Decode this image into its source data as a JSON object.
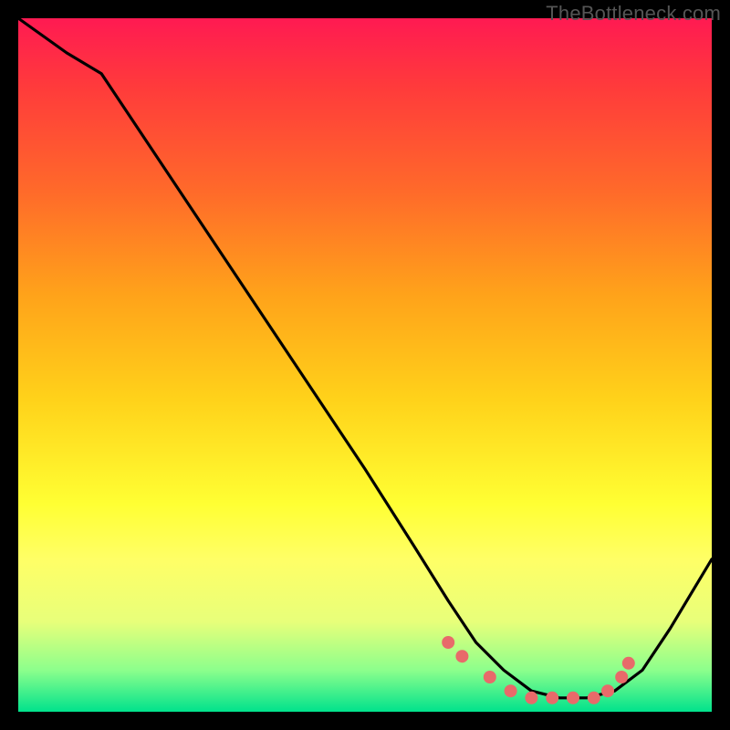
{
  "watermark": "TheBottleneck.com",
  "chart_data": {
    "type": "line",
    "title": "",
    "xlabel": "",
    "ylabel": "",
    "xlim": [
      0,
      100
    ],
    "ylim": [
      0,
      100
    ],
    "series": [
      {
        "name": "curve",
        "x": [
          0,
          7,
          12,
          20,
          30,
          40,
          50,
          57,
          62,
          66,
          70,
          74,
          78,
          82,
          86,
          90,
          94,
          100
        ],
        "y": [
          100,
          95,
          92,
          80,
          65,
          50,
          35,
          24,
          16,
          10,
          6,
          3,
          2,
          2,
          3,
          6,
          12,
          22
        ]
      }
    ],
    "markers": {
      "name": "highlight-points",
      "color": "#e86a6a",
      "radius": 7,
      "x": [
        62,
        64,
        68,
        71,
        74,
        77,
        80,
        83,
        85,
        87,
        88
      ],
      "y": [
        10,
        8,
        5,
        3,
        2,
        2,
        2,
        2,
        3,
        5,
        7
      ]
    }
  }
}
